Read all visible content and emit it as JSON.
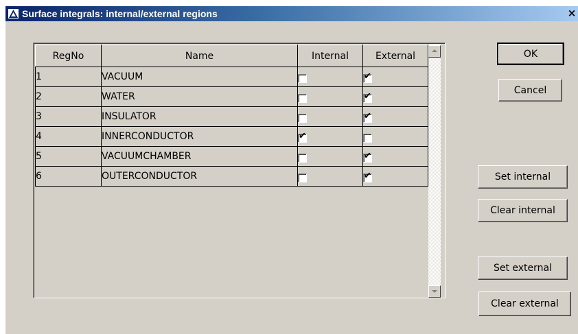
{
  "window": {
    "title": "Surface integrals: internal/external regions",
    "close_glyph": "×"
  },
  "grid": {
    "columns": [
      "RegNo",
      "Name",
      "Internal",
      "External"
    ],
    "rows": [
      {
        "regno": "1",
        "name": "VACUUM",
        "internal": false,
        "external": true
      },
      {
        "regno": "2",
        "name": "WATER",
        "internal": false,
        "external": true
      },
      {
        "regno": "3",
        "name": "INSULATOR",
        "internal": false,
        "external": true
      },
      {
        "regno": "4",
        "name": "INNERCONDUCTOR",
        "internal": true,
        "external": false
      },
      {
        "regno": "5",
        "name": "VACUUMCHAMBER",
        "internal": false,
        "external": true
      },
      {
        "regno": "6",
        "name": "OUTERCONDUCTOR",
        "internal": false,
        "external": true
      }
    ]
  },
  "buttons": {
    "ok": "OK",
    "cancel": "Cancel",
    "set_internal": "Set internal",
    "clear_internal": "Clear internal",
    "set_external": "Set external",
    "clear_external": "Clear external"
  },
  "icons": {
    "app": "app-logo-icon",
    "check": "✔"
  }
}
